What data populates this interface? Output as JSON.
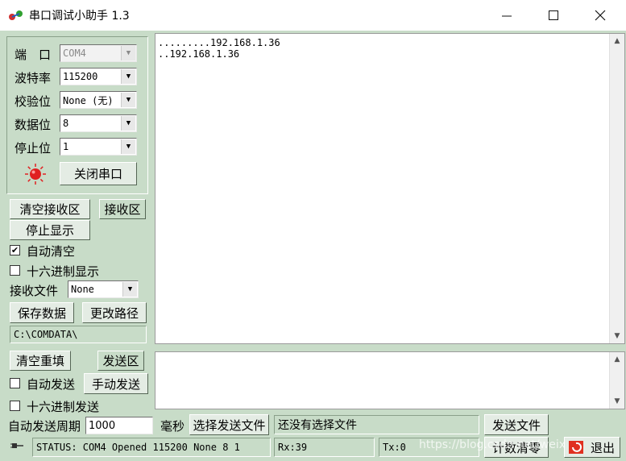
{
  "window": {
    "title": "串口调试小助手 1.3"
  },
  "port_settings": {
    "port": {
      "label": "端　口",
      "value": "COM4"
    },
    "baud": {
      "label": "波特率",
      "value": "115200"
    },
    "parity": {
      "label": "校验位",
      "value": "None (无)"
    },
    "databits": {
      "label": "数据位",
      "value": "8"
    },
    "stopbits": {
      "label": "停止位",
      "value": "1"
    },
    "toggle_button": "关闭串口"
  },
  "receive": {
    "clear_button": "清空接收区",
    "area_button": "接收区",
    "stop_display_button": "停止显示",
    "auto_clear": {
      "label": "自动清空",
      "checked": true
    },
    "hex_display": {
      "label": "十六进制显示",
      "checked": false
    },
    "file_label": "接收文件",
    "file_value": "None",
    "save_button": "保存数据",
    "change_path_button": "更改路径",
    "path": "C:\\COMDATA\\",
    "text": ".........192.168.1.36\n..192.168.1.36"
  },
  "send": {
    "clear_button": "清空重填",
    "area_button": "发送区",
    "auto_send": {
      "label": "自动发送",
      "checked": false
    },
    "manual_send_button": "手动发送",
    "hex_send": {
      "label": "十六进制发送",
      "checked": false
    },
    "period_label": "自动发送周期",
    "period_value": "1000",
    "period_unit": "毫秒",
    "select_file_button": "选择发送文件",
    "file_status": "还没有选择文件",
    "send_file_button": "发送文件",
    "reset_count_button": "计数清零",
    "exit_button": "退出"
  },
  "statusbar": {
    "status": "STATUS: COM4 Opened 115200 None  8 1",
    "rx": "Rx:39",
    "tx": "Tx:0",
    "watermark": "https://blog.csdn.net/weixin_45"
  },
  "colors": {
    "panel": "#c8dcc8",
    "led": "#e02020"
  }
}
